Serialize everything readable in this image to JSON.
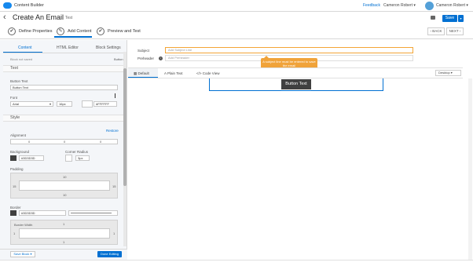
{
  "topbar": {
    "app_name": "Content Builder",
    "feedback": "Feedback",
    "user_menu": "Cameron Robert ▾",
    "user_account": "Cameron Robert ▾"
  },
  "header": {
    "title": "Create An Email",
    "subtitle": "Test",
    "save_label": "Save",
    "save_caret": "▾"
  },
  "steps": [
    {
      "label": "Define Properties",
      "icon": "✔"
    },
    {
      "label": "Add Content",
      "icon": "✎"
    },
    {
      "label": "Preview and Test",
      "icon": "✔"
    }
  ],
  "nav": {
    "back": "‹ BACK",
    "next": "NEXT ›"
  },
  "left_panel": {
    "tabs": [
      "Content",
      "HTML Editor",
      "Block Settings"
    ],
    "block_name": "Block not saved",
    "block_type": "Button",
    "text_section": "Text",
    "button_text_label": "Button Text",
    "button_text_value": "Button Text",
    "font_label": "Font",
    "font_value": "Arial",
    "font_caret": "▾",
    "size_value": "16px",
    "color_value": "#FFFFFF",
    "style_section": "Style",
    "restore": "Restore",
    "alignment_label": "Alignment",
    "alignment_values": [
      "0",
      "0",
      "0"
    ],
    "background_label": "Background",
    "background_value": "#3D3D3D",
    "background_color": "#404040",
    "radius_label": "Corner Radius",
    "radius_value": "3px",
    "padding_label": "Padding",
    "padding_values": {
      "top": "10",
      "left": "15",
      "right": "15",
      "bottom": "10"
    },
    "border_label": "Border",
    "border_value": "#3D3D3D",
    "border_width_label": "Border Width",
    "border_width_values": {
      "top": "1",
      "left": "1",
      "right": "1",
      "bottom": "1"
    },
    "save_block": "Save Block ▾",
    "done_editing": "Done Editing"
  },
  "email": {
    "subject_label": "Subject",
    "subject_placeholder": "Add Subject Line",
    "preheader_label": "Preheader",
    "preheader_placeholder": "Add Preheader",
    "warning": "A subject line must be entered to save the email",
    "view_tabs": [
      "Default",
      "Plain Text",
      "Code View"
    ],
    "device": "Desktop ▾",
    "button_text": "Button Text",
    "accent": "#0070d2",
    "warning_color": "#f0a33a"
  }
}
